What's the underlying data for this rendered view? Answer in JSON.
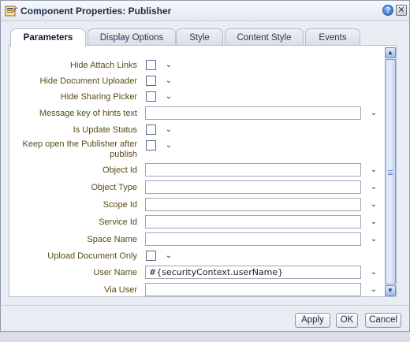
{
  "window": {
    "title": "Component Properties: Publisher",
    "help_glyph": "?",
    "close_glyph": "✕"
  },
  "tabs": [
    {
      "label": "Parameters",
      "active": true
    },
    {
      "label": "Display Options",
      "active": false
    },
    {
      "label": "Style",
      "active": false
    },
    {
      "label": "Content Style",
      "active": false
    },
    {
      "label": "Events",
      "active": false
    }
  ],
  "fields": {
    "hide_attach_links": {
      "label": "Hide Attach Links",
      "type": "checkbox",
      "checked": false
    },
    "hide_document_uploader": {
      "label": "Hide Document Uploader",
      "type": "checkbox",
      "checked": false
    },
    "hide_sharing_picker": {
      "label": "Hide Sharing Picker",
      "type": "checkbox",
      "checked": false
    },
    "message_key_hints": {
      "label": "Message key of hints text",
      "type": "text",
      "value": ""
    },
    "is_update_status": {
      "label": "Is Update Status",
      "type": "checkbox",
      "checked": false
    },
    "keep_open_line1": "Keep open the Publisher after",
    "keep_open_line2": "publish",
    "object_id": {
      "label": "Object Id",
      "type": "text",
      "value": ""
    },
    "object_type": {
      "label": "Object Type",
      "type": "text",
      "value": ""
    },
    "scope_id": {
      "label": "Scope Id",
      "type": "text",
      "value": ""
    },
    "service_id": {
      "label": "Service Id",
      "type": "text",
      "value": ""
    },
    "space_name": {
      "label": "Space Name",
      "type": "text",
      "value": ""
    },
    "upload_document_only": {
      "label": "Upload Document Only",
      "type": "checkbox",
      "checked": false
    },
    "user_name": {
      "label": "User Name",
      "type": "text",
      "value": "#{securityContext.userName}"
    },
    "via_user": {
      "label": "Via User",
      "type": "text",
      "value": ""
    }
  },
  "footer": {
    "apply_label": "Apply",
    "ok_label": "OK",
    "cancel_label": "Cancel"
  },
  "icons": {
    "dropdown": "chevron-down-icon",
    "title": "properties-icon"
  },
  "colors": {
    "label_text": "#5b4a1a",
    "accent": "#2c63b8"
  }
}
